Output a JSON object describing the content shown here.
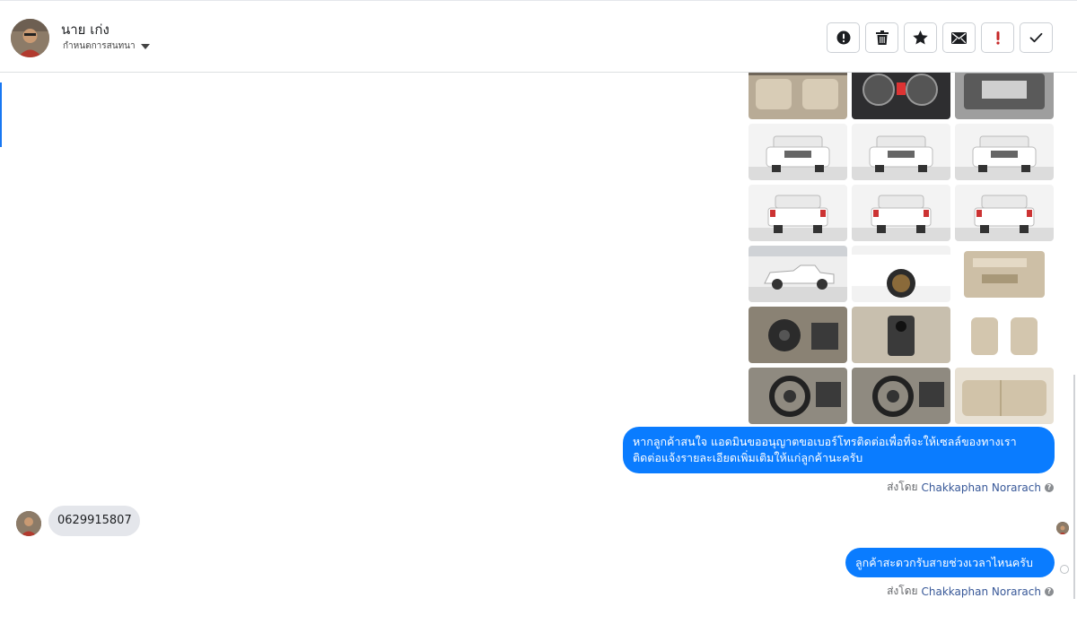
{
  "header": {
    "contact_name": "นาย เก่ง",
    "status_label": "กำหนดการสนทนา",
    "actions": [
      {
        "name": "spam-button",
        "icon": "alert-circle-icon"
      },
      {
        "name": "delete-button",
        "icon": "trash-icon"
      },
      {
        "name": "star-button",
        "icon": "star-icon"
      },
      {
        "name": "mark-unread-button",
        "icon": "envelope-icon"
      },
      {
        "name": "important-button",
        "icon": "exclamation-icon"
      },
      {
        "name": "done-button",
        "icon": "checkmark-icon"
      }
    ],
    "accent_color": "#c62828"
  },
  "gallery": {
    "rows": [
      [
        "interior-rear-seats",
        "dashboard-gauges",
        "engine-bay"
      ],
      [
        "front-view",
        "front-view",
        "front-view"
      ],
      [
        "rear-view",
        "rear-view",
        "rear-view"
      ],
      [
        "side-view",
        "wheel-closeup",
        "door-panel"
      ],
      [
        "dashboard-left",
        "gear-console",
        "front-seats"
      ],
      [
        "steering-wheel",
        "steering-wheel",
        "back-seats"
      ]
    ]
  },
  "messages": {
    "outgoing_1": {
      "line1": "หากลูกค้าสนใจ แอดมินขออนุญาตขอเบอร์โทรติดต่อเพื่อที่จะให้เซลล์ของทางเรา",
      "line2": "ติดต่อแจ้งรายละเอียดเพิ่มเติมให้แก่ลูกค้านะครับ",
      "sent_by_prefix": "ส่งโดย",
      "sent_by_name": "Chakkaphan Norarach"
    },
    "incoming_1": {
      "text": "0629915807"
    },
    "outgoing_2": {
      "text": "ลูกค้าสะดวกรับสายช่วงเวลาไหนครับ",
      "sent_by_prefix": "ส่งโดย",
      "sent_by_name": "Chakkaphan Norarach"
    }
  },
  "colors": {
    "bubble_out": "#0a7cff",
    "bubble_in": "#e4e6eb",
    "sender_link": "#385898"
  }
}
